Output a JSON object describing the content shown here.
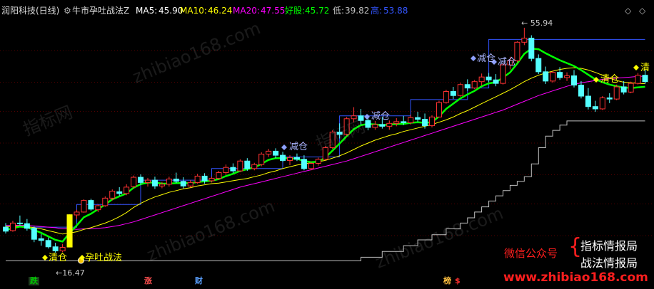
{
  "header": {
    "stock_title": "润阳科技(日线)",
    "indicator_name": "牛市孕吐战法Z",
    "ma5": {
      "label": "MA5:",
      "value": "45.90",
      "color": "#ffffff"
    },
    "ma10": {
      "label": "MA10:",
      "value": "46.24",
      "color": "#ffff00"
    },
    "ma20": {
      "label": "MA20:",
      "value": "47.55",
      "color": "#ff00ff"
    },
    "good": {
      "label": "好股:",
      "value": "45.72",
      "color": "#00ff00"
    },
    "low": {
      "label": "低:",
      "value": "39.82",
      "color": "#c0c0c0"
    },
    "high": {
      "label": "高:",
      "value": "53.88",
      "color": "#3355ff"
    }
  },
  "controls": {
    "settings_icon": "gear-icon",
    "up_icon": "diamond-up-icon",
    "down_icon": "diamond-down-icon"
  },
  "watermarks": [
    "指标网",
    "zhibiao168.com",
    "指标网",
    "zhibiao168.com",
    "zhibiao168.com"
  ],
  "promo": {
    "wechat_label": "微信公众号",
    "line1": "指标情报局",
    "line2": "战法情报局",
    "url": "www.zhibiao168.com"
  },
  "annotations": {
    "clear_left": "清仓",
    "pattern": "孕吐战法",
    "reduce1": "减仓",
    "reduce2": "减仓",
    "reduce3": "减仓",
    "reduce4": "减仓",
    "clear_right": "清仓",
    "clear_far": "清",
    "low_price": "16.47",
    "high_price": "55.94"
  },
  "bottom_labels": {
    "die": "跌",
    "zhang": "涨",
    "cai": "财",
    "bang": "榜",
    "money": "$"
  },
  "colors": {
    "up": "#ff3232",
    "down": "#54ffff",
    "ma10": "#ffff00",
    "ma20": "#ff00ff",
    "good": "#00ff00",
    "low": "#c0c0c0",
    "high": "#3355ff",
    "signal": "#ffff00"
  },
  "chart_data": {
    "type": "candlestick",
    "price_range": [
      15,
      57
    ],
    "candles": [
      [
        21.5,
        22.2,
        20.4,
        20.8
      ],
      [
        20.9,
        22.6,
        20.7,
        22.2
      ],
      [
        22.2,
        23.5,
        21.8,
        22.1
      ],
      [
        22.1,
        22.9,
        20.9,
        21.3
      ],
      [
        21.3,
        21.6,
        18.9,
        19.4
      ],
      [
        19.5,
        20.3,
        18.3,
        19.2
      ],
      [
        19.2,
        19.7,
        17.8,
        18.1
      ],
      [
        18.1,
        18.8,
        17.1,
        17.4
      ],
      [
        17.4,
        18.6,
        17.2,
        18.0
      ],
      [
        18.1,
        23.7,
        18.0,
        23.5
      ],
      [
        23.6,
        24.5,
        22.9,
        24.1
      ],
      [
        24.1,
        26.3,
        24.0,
        26.1
      ],
      [
        26.1,
        26.4,
        24.3,
        24.6
      ],
      [
        24.5,
        25.4,
        24.1,
        25.2
      ],
      [
        25.2,
        26.8,
        25.0,
        26.5
      ],
      [
        26.5,
        28.0,
        26.1,
        27.7
      ],
      [
        27.6,
        28.4,
        26.9,
        27.3
      ],
      [
        27.3,
        28.9,
        27.0,
        28.4
      ],
      [
        28.5,
        30.4,
        28.1,
        30.1
      ],
      [
        30.1,
        30.6,
        28.8,
        29.2
      ],
      [
        29.2,
        30.0,
        28.5,
        29.6
      ],
      [
        29.6,
        30.2,
        28.1,
        28.6
      ],
      [
        28.6,
        29.3,
        28.2,
        28.9
      ],
      [
        28.9,
        30.2,
        28.5,
        29.8
      ],
      [
        29.8,
        30.9,
        29.1,
        29.4
      ],
      [
        29.4,
        30.1,
        28.2,
        28.6
      ],
      [
        28.6,
        29.6,
        28.3,
        29.2
      ],
      [
        29.2,
        30.7,
        29.0,
        30.3
      ],
      [
        30.3,
        30.8,
        29.0,
        29.5
      ],
      [
        29.5,
        30.2,
        29.2,
        29.9
      ],
      [
        29.9,
        31.2,
        29.7,
        30.9
      ],
      [
        30.9,
        32.3,
        30.5,
        31.8
      ],
      [
        31.8,
        32.5,
        30.8,
        31.2
      ],
      [
        31.2,
        33.2,
        31.0,
        32.9
      ],
      [
        32.9,
        33.4,
        31.2,
        31.6
      ],
      [
        31.6,
        32.6,
        31.3,
        32.3
      ],
      [
        32.3,
        34.4,
        32.0,
        34.1
      ],
      [
        34.1,
        35.0,
        33.6,
        34.6
      ],
      [
        34.6,
        35.1,
        33.4,
        33.9
      ],
      [
        33.9,
        34.5,
        32.7,
        33.0
      ],
      [
        33.0,
        33.9,
        32.2,
        33.5
      ],
      [
        33.5,
        34.2,
        32.9,
        33.2
      ],
      [
        33.2,
        33.9,
        31.3,
        31.6
      ],
      [
        31.6,
        32.8,
        31.3,
        32.5
      ],
      [
        32.5,
        33.5,
        32.1,
        33.2
      ],
      [
        33.2,
        35.5,
        33.0,
        35.2
      ],
      [
        35.2,
        38.2,
        35.0,
        37.9
      ],
      [
        37.9,
        39.4,
        36.8,
        37.5
      ],
      [
        37.5,
        40.5,
        37.2,
        40.2
      ],
      [
        40.2,
        42.2,
        39.6,
        40.7
      ],
      [
        40.7,
        41.9,
        39.2,
        39.9
      ],
      [
        39.9,
        40.9,
        38.2,
        38.7
      ],
      [
        38.7,
        39.8,
        38.3,
        39.2
      ],
      [
        39.2,
        40.5,
        38.5,
        38.9
      ],
      [
        38.9,
        39.9,
        38.3,
        39.4
      ],
      [
        39.4,
        40.3,
        38.9,
        39.7
      ],
      [
        39.7,
        40.7,
        39.1,
        39.5
      ],
      [
        39.5,
        40.9,
        39.2,
        40.4
      ],
      [
        40.4,
        41.4,
        39.7,
        40.1
      ],
      [
        40.1,
        41.1,
        38.5,
        39.0
      ],
      [
        39.0,
        40.8,
        38.7,
        40.5
      ],
      [
        40.5,
        43.3,
        40.4,
        43.0
      ],
      [
        43.0,
        45.2,
        42.8,
        44.9
      ],
      [
        44.9,
        45.7,
        43.6,
        44.2
      ],
      [
        44.2,
        46.4,
        44.0,
        46.1
      ],
      [
        46.1,
        47.0,
        45.0,
        45.5
      ],
      [
        45.5,
        46.9,
        45.3,
        46.6
      ],
      [
        46.6,
        48.0,
        45.9,
        47.4
      ],
      [
        47.4,
        48.1,
        46.5,
        46.9
      ],
      [
        46.9,
        47.9,
        45.8,
        46.3
      ],
      [
        46.3,
        49.8,
        46.1,
        49.5
      ],
      [
        49.5,
        50.9,
        48.7,
        50.2
      ],
      [
        50.2,
        53.6,
        49.9,
        53.4
      ],
      [
        53.4,
        55.9,
        52.9,
        54.1
      ],
      [
        54.1,
        54.6,
        50.1,
        50.6
      ],
      [
        50.6,
        51.3,
        47.9,
        48.3
      ],
      [
        48.3,
        49.2,
        46.2,
        46.7
      ],
      [
        46.7,
        48.5,
        46.4,
        48.2
      ],
      [
        48.2,
        49.1,
        46.9,
        47.3
      ],
      [
        47.3,
        48.2,
        46.7,
        47.6
      ],
      [
        47.6,
        48.6,
        45.6,
        46.0
      ],
      [
        46.0,
        46.7,
        43.7,
        44.1
      ],
      [
        44.1,
        45.5,
        41.8,
        42.3
      ],
      [
        42.3,
        43.3,
        41.4,
        41.9
      ],
      [
        41.9,
        44.1,
        41.7,
        43.8
      ],
      [
        43.8,
        44.6,
        42.9,
        43.6
      ],
      [
        43.6,
        46.1,
        43.4,
        45.7
      ],
      [
        45.7,
        46.7,
        44.4,
        44.8
      ],
      [
        44.8,
        46.6,
        44.6,
        46.3
      ],
      [
        46.3,
        48.1,
        46.1,
        47.7
      ],
      [
        47.7,
        48.7,
        46.2,
        46.6
      ]
    ],
    "ma10": [
      21.6,
      21.6,
      21.7,
      21.6,
      21.4,
      21.2,
      20.9,
      20.6,
      20.3,
      20.5,
      20.7,
      21.1,
      21.4,
      21.8,
      22.2,
      22.7,
      23.3,
      24.0,
      24.9,
      25.6,
      26.2,
      26.7,
      27.1,
      27.5,
      27.8,
      28.1,
      28.3,
      28.6,
      28.8,
      29.0,
      29.1,
      29.3,
      29.5,
      29.7,
      29.9,
      30.2,
      30.5,
      30.9,
      31.2,
      31.6,
      31.9,
      32.2,
      32.4,
      32.6,
      32.8,
      33.0,
      33.4,
      33.8,
      34.3,
      34.9,
      35.5,
      36.0,
      36.5,
      36.9,
      37.3,
      37.6,
      38.0,
      38.3,
      38.6,
      38.9,
      39.2,
      39.6,
      40.0,
      40.5,
      41.1,
      41.6,
      42.2,
      42.8,
      43.4,
      44.0,
      44.6,
      45.2,
      45.9,
      46.6,
      47.2,
      47.7,
      48.1,
      48.4,
      48.7,
      48.9,
      49.0,
      48.9,
      48.6,
      48.2,
      47.7,
      47.2,
      46.8,
      46.5,
      46.4,
      46.3,
      46.24
    ],
    "ma20": [
      21.8,
      21.8,
      21.8,
      21.8,
      21.7,
      21.6,
      21.5,
      21.4,
      21.2,
      21.2,
      21.1,
      21.2,
      21.2,
      21.3,
      21.4,
      21.6,
      21.8,
      22.1,
      22.4,
      22.8,
      23.2,
      23.6,
      24.0,
      24.4,
      24.8,
      25.2,
      25.6,
      26.0,
      26.4,
      26.8,
      27.2,
      27.6,
      28.0,
      28.4,
      28.7,
      29.0,
      29.3,
      29.6,
      29.9,
      30.2,
      30.5,
      30.8,
      31.1,
      31.4,
      31.7,
      32.0,
      32.3,
      32.6,
      32.9,
      33.3,
      33.7,
      34.1,
      34.5,
      34.9,
      35.3,
      35.7,
      36.1,
      36.5,
      36.9,
      37.3,
      37.7,
      38.1,
      38.5,
      38.9,
      39.3,
      39.7,
      40.1,
      40.5,
      40.9,
      41.3,
      41.7,
      42.2,
      42.7,
      43.2,
      43.7,
      44.2,
      44.6,
      45.0,
      45.4,
      45.8,
      46.1,
      46.4,
      46.6,
      46.8,
      47.0,
      47.1,
      47.2,
      47.3,
      47.4,
      47.5,
      47.55
    ],
    "good": [
      21.0,
      21.3,
      21.6,
      21.5,
      21.0,
      20.5,
      19.9,
      19.3,
      19.0,
      20.5,
      21.8,
      23.2,
      23.8,
      24.6,
      25.4,
      26.3,
      26.8,
      27.3,
      28.3,
      28.9,
      29.2,
      29.2,
      29.0,
      29.0,
      29.1,
      29.1,
      29.1,
      29.3,
      29.4,
      29.5,
      29.8,
      30.3,
      30.7,
      31.2,
      31.5,
      31.8,
      32.4,
      33.1,
      33.4,
      33.4,
      33.4,
      33.3,
      32.9,
      32.7,
      32.8,
      33.5,
      34.7,
      35.9,
      37.2,
      38.4,
      39.1,
      39.3,
      39.2,
      39.1,
      39.2,
      39.3,
      39.3,
      39.5,
      39.6,
      39.5,
      39.6,
      40.6,
      41.9,
      42.8,
      43.7,
      44.4,
      45.0,
      45.8,
      46.3,
      46.5,
      47.3,
      48.2,
      49.7,
      51.4,
      52.3,
      52.2,
      51.5,
      50.9,
      50.3,
      49.8,
      49.3,
      48.6,
      47.8,
      47.0,
      46.5,
      46.1,
      45.8,
      45.6,
      45.5,
      45.6,
      45.72
    ],
    "support": [
      [
        0,
        15.7
      ],
      [
        50,
        15.7
      ],
      [
        50,
        16.3
      ],
      [
        53,
        16.3
      ],
      [
        53,
        17.3
      ],
      [
        56,
        17.3
      ],
      [
        56,
        18.3
      ],
      [
        58,
        18.3
      ],
      [
        58,
        19.3
      ],
      [
        60,
        19.3
      ],
      [
        60,
        20.2
      ],
      [
        62,
        20.2
      ],
      [
        62,
        21.2
      ],
      [
        64,
        21.2
      ],
      [
        64,
        22.2
      ],
      [
        65,
        22.2
      ],
      [
        65,
        23.1
      ],
      [
        66,
        23.1
      ],
      [
        66,
        24.1
      ],
      [
        67,
        24.1
      ],
      [
        67,
        25.0
      ],
      [
        68,
        25.0
      ],
      [
        68,
        26.0
      ],
      [
        69,
        26.0
      ],
      [
        69,
        26.9
      ],
      [
        70,
        26.9
      ],
      [
        70,
        27.8
      ],
      [
        71,
        27.8
      ],
      [
        71,
        28.7
      ],
      [
        72,
        28.7
      ],
      [
        72,
        29.4
      ],
      [
        73,
        29.4
      ],
      [
        73,
        30.2
      ],
      [
        74,
        30.2
      ],
      [
        74,
        32.4
      ],
      [
        75,
        32.4
      ],
      [
        75,
        35.2
      ],
      [
        76,
        35.2
      ],
      [
        76,
        37.2
      ],
      [
        77,
        37.2
      ],
      [
        77,
        38.2
      ],
      [
        78,
        38.2
      ],
      [
        78,
        39.1
      ],
      [
        79,
        39.1
      ],
      [
        79,
        39.82
      ],
      [
        90,
        39.82
      ]
    ],
    "resistance": [
      [
        2,
        21.5
      ],
      [
        10,
        21.5
      ],
      [
        10,
        25.4
      ],
      [
        19,
        25.4
      ],
      [
        19,
        29.6
      ],
      [
        29,
        29.6
      ],
      [
        29,
        31.6
      ],
      [
        39,
        31.6
      ],
      [
        39,
        33.6
      ],
      [
        47,
        33.6
      ],
      [
        47,
        40.7
      ],
      [
        57,
        40.7
      ],
      [
        57,
        43.5
      ],
      [
        65,
        43.5
      ],
      [
        65,
        45.5
      ],
      [
        68,
        45.5
      ],
      [
        68,
        53.88
      ],
      [
        90,
        53.88
      ]
    ]
  }
}
